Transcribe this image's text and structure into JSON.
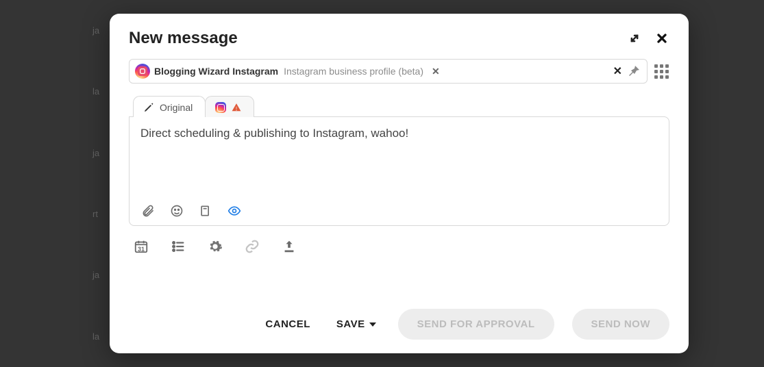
{
  "modal": {
    "title": "New message"
  },
  "account": {
    "name": "Blogging Wizard Instagram",
    "subtitle": "Instagram business profile (beta)"
  },
  "tabs": {
    "original": "Original"
  },
  "editor": {
    "text": "Direct scheduling & publishing to Instagram, wahoo!"
  },
  "options": {
    "calendar_day": "31"
  },
  "footer": {
    "cancel": "CANCEL",
    "save": "SAVE",
    "send_approval": "SEND FOR APPROVAL",
    "send_now": "SEND NOW"
  }
}
